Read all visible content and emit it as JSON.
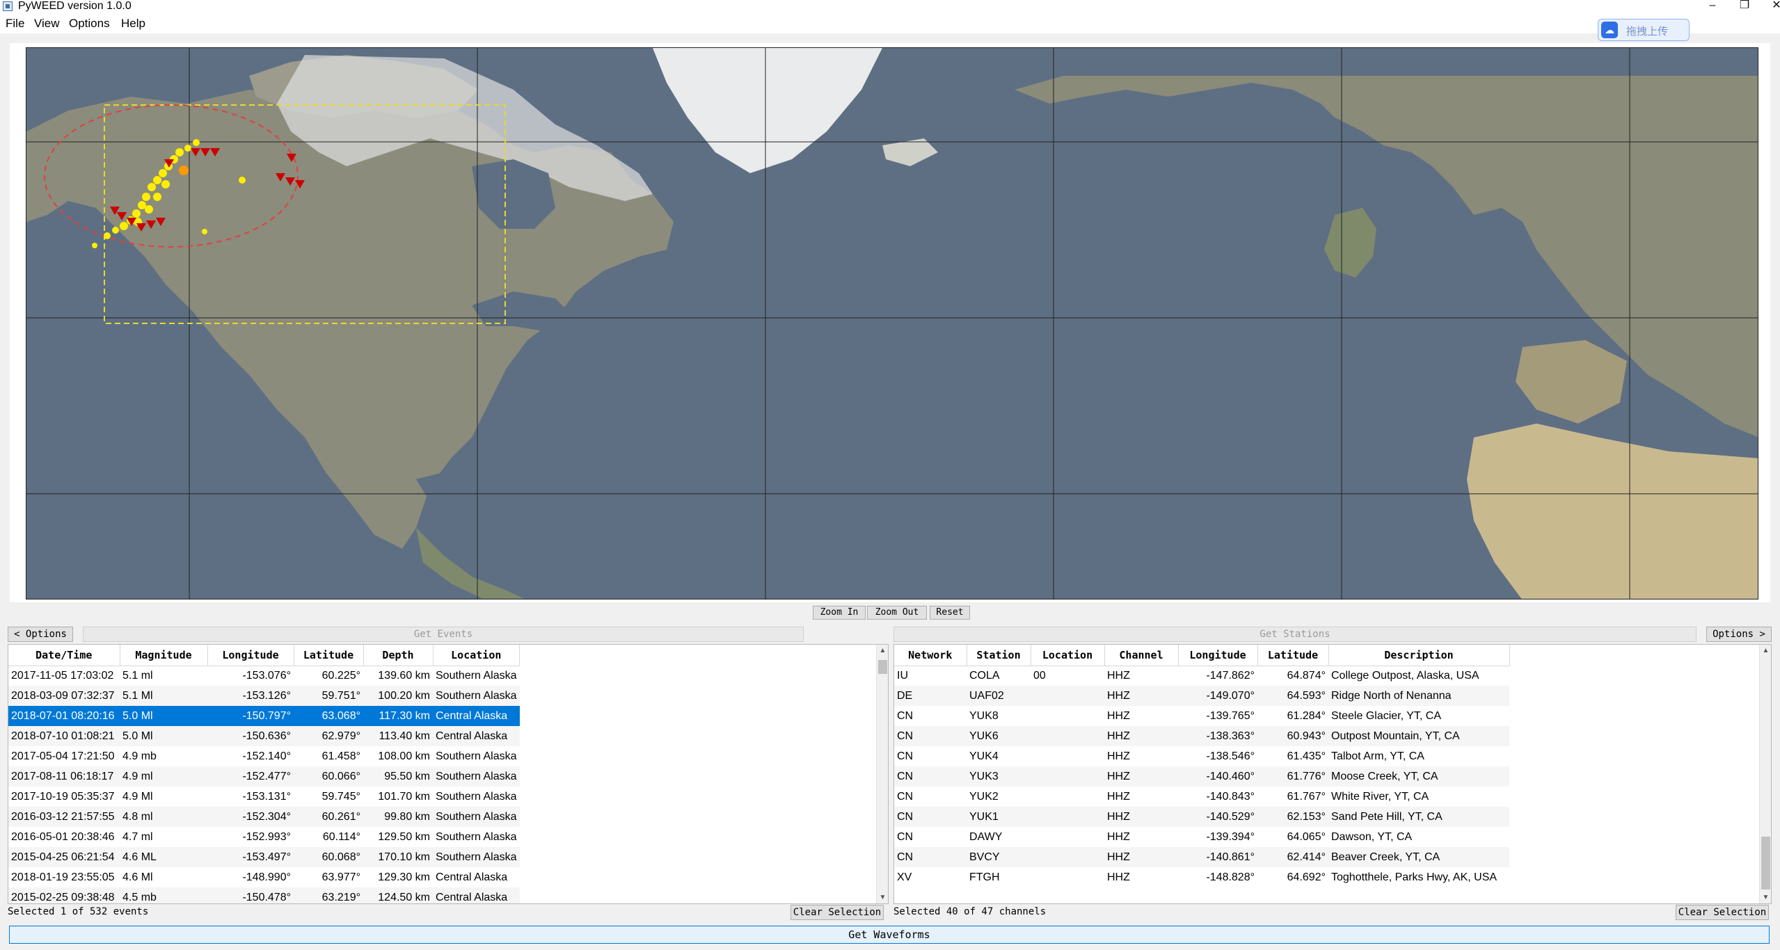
{
  "window": {
    "title": "PyWEED version 1.0.0",
    "min": "–",
    "max": "❐",
    "close": "✕"
  },
  "menu": [
    "File",
    "View",
    "Options",
    "Help"
  ],
  "upload_widget": {
    "label": "拖拽上传",
    "icon": "cloud-icon"
  },
  "map": {
    "region_box_color": "#e8d832",
    "radius_circle_color": "#e04040",
    "event_color": "#ffee00",
    "selected_event_color": "#ff9900",
    "station_color": "#cc0000"
  },
  "zoom": {
    "in": "Zoom In",
    "out": "Zoom Out",
    "reset": "Reset"
  },
  "events": {
    "options_label": "< Options",
    "get_label": "Get Events",
    "columns": [
      "Date/Time",
      "Magnitude",
      "Longitude",
      "Latitude",
      "Depth",
      "Location"
    ],
    "rows": [
      [
        "2017-11-05 17:03:02",
        "5.1 ml",
        "-153.076°",
        "60.225°",
        "139.60 km",
        "Southern Alaska"
      ],
      [
        "2018-03-09 07:32:37",
        "5.1 Ml",
        "-153.126°",
        "59.751°",
        "100.20 km",
        "Southern Alaska"
      ],
      [
        "2018-07-01 08:20:16",
        "5.0 Ml",
        "-150.797°",
        "63.068°",
        "117.30 km",
        "Central Alaska"
      ],
      [
        "2018-07-10 01:08:21",
        "5.0 Ml",
        "-150.636°",
        "62.979°",
        "113.40 km",
        "Central Alaska"
      ],
      [
        "2017-05-04 17:21:50",
        "4.9 mb",
        "-152.140°",
        "61.458°",
        "108.00 km",
        "Southern Alaska"
      ],
      [
        "2017-08-11 06:18:17",
        "4.9 ml",
        "-152.477°",
        "60.066°",
        "95.50 km",
        "Southern Alaska"
      ],
      [
        "2017-10-19 05:35:37",
        "4.9 Ml",
        "-153.131°",
        "59.745°",
        "101.70 km",
        "Southern Alaska"
      ],
      [
        "2016-03-12 21:57:55",
        "4.8 ml",
        "-152.304°",
        "60.261°",
        "99.80 km",
        "Southern Alaska"
      ],
      [
        "2016-05-01 20:38:46",
        "4.7 ml",
        "-152.993°",
        "60.114°",
        "129.50 km",
        "Southern Alaska"
      ],
      [
        "2015-04-25 06:21:54",
        "4.6 ML",
        "-153.497°",
        "60.068°",
        "170.10 km",
        "Southern Alaska"
      ],
      [
        "2018-01-19 23:55:05",
        "4.6 Ml",
        "-148.990°",
        "63.977°",
        "129.30 km",
        "Central Alaska"
      ],
      [
        "2015-02-25 09:38:48",
        "4.5 mb",
        "-150.478°",
        "63.219°",
        "124.50 km",
        "Central Alaska"
      ]
    ],
    "selected_index": 2,
    "status": "Selected 1 of 532 events",
    "clear_label": "Clear Selection"
  },
  "stations": {
    "options_label": "Options >",
    "get_label": "Get Stations",
    "columns": [
      "Network",
      "Station",
      "Location",
      "Channel",
      "Longitude",
      "Latitude",
      "Description"
    ],
    "rows": [
      [
        "IU",
        "COLA",
        "00",
        "HHZ",
        "-147.862°",
        "64.874°",
        "College Outpost, Alaska, USA"
      ],
      [
        "DE",
        "UAF02",
        "",
        "HHZ",
        "-149.070°",
        "64.593°",
        "Ridge North of Nenanna"
      ],
      [
        "CN",
        "YUK8",
        "",
        "HHZ",
        "-139.765°",
        "61.284°",
        "Steele Glacier, YT, CA"
      ],
      [
        "CN",
        "YUK6",
        "",
        "HHZ",
        "-138.363°",
        "60.943°",
        "Outpost Mountain, YT, CA"
      ],
      [
        "CN",
        "YUK4",
        "",
        "HHZ",
        "-138.546°",
        "61.435°",
        "Talbot Arm, YT, CA"
      ],
      [
        "CN",
        "YUK3",
        "",
        "HHZ",
        "-140.460°",
        "61.776°",
        "Moose Creek, YT, CA"
      ],
      [
        "CN",
        "YUK2",
        "",
        "HHZ",
        "-140.843°",
        "61.767°",
        "White River, YT, CA"
      ],
      [
        "CN",
        "YUK1",
        "",
        "HHZ",
        "-140.529°",
        "62.153°",
        "Sand Pete Hill, YT, CA"
      ],
      [
        "CN",
        "DAWY",
        "",
        "HHZ",
        "-139.394°",
        "64.065°",
        "Dawson, YT, CA"
      ],
      [
        "CN",
        "BVCY",
        "",
        "HHZ",
        "-140.861°",
        "62.414°",
        "Beaver Creek, YT, CA"
      ],
      [
        "XV",
        "FTGH",
        "",
        "HHZ",
        "-148.828°",
        "64.692°",
        "Toghotthele, Parks Hwy, AK, USA"
      ]
    ],
    "status": "Selected 40 of 47 channels",
    "clear_label": "Clear Selection"
  },
  "get_waveforms_label": "Get Waveforms"
}
